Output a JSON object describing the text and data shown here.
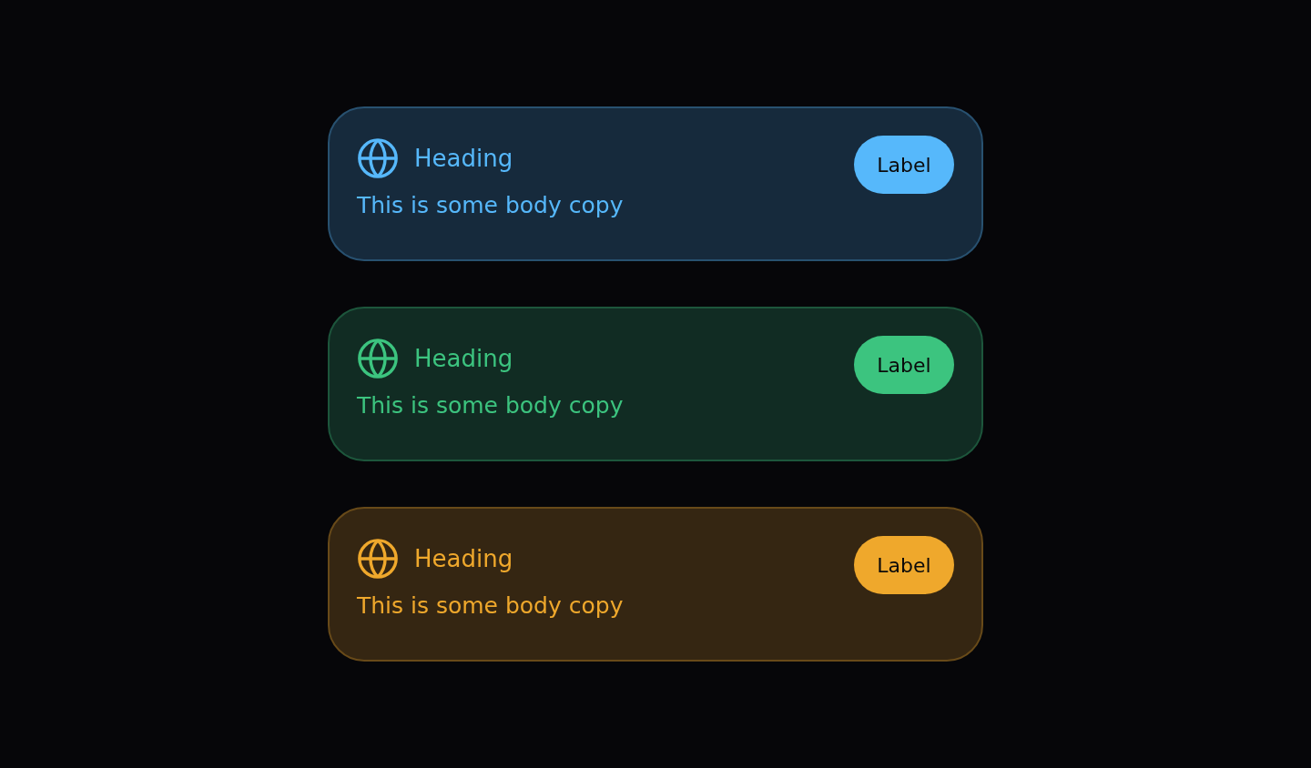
{
  "cards": [
    {
      "heading": "Heading",
      "body": "This is some body copy",
      "label": "Label",
      "color": "#56b8fb"
    },
    {
      "heading": "Heading",
      "body": "This is some body copy",
      "label": "Label",
      "color": "#3cc47f"
    },
    {
      "heading": "Heading",
      "body": "This is some body copy",
      "label": "Label",
      "color": "#efa82c"
    }
  ]
}
